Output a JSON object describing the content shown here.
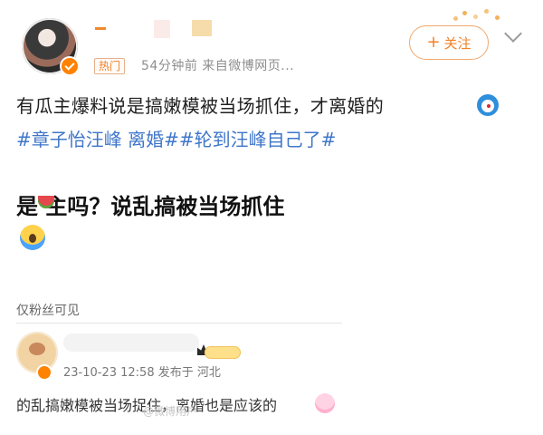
{
  "header": {
    "badge": "热门",
    "time_source": "54分钟前  来自微博网页...",
    "follow_label": "关注"
  },
  "post": {
    "body": "有瓜主爆料说是搞嫩模被当场抓住，才离婚的",
    "tags": [
      "#章子怡汪峰 离婚#",
      "#轮到汪峰自己了#"
    ]
  },
  "embedded": {
    "headline": "是    主吗？说乱搞被当场抓住",
    "fans_only": "仅粉丝可见",
    "comment_meta": "23-10-23 12:58  发布于 河北",
    "comment_text": "的乱搞嫩模被当场捉住，离婚也是应该的",
    "watermark": "@微博用户"
  },
  "icons": {
    "follow": "plus-icon",
    "more": "chevron-down-icon",
    "verified": "verified-badge-icon",
    "emoji_1": "doraemon-emoji-icon",
    "emoji_2": "watermelon-emoji-icon",
    "emoji_3": "shocked-face-emoji-icon",
    "emoji_4": "bunny-emoji-icon"
  },
  "colors": {
    "accent_orange": "#f0822a",
    "tag_blue": "#3f76c9"
  }
}
